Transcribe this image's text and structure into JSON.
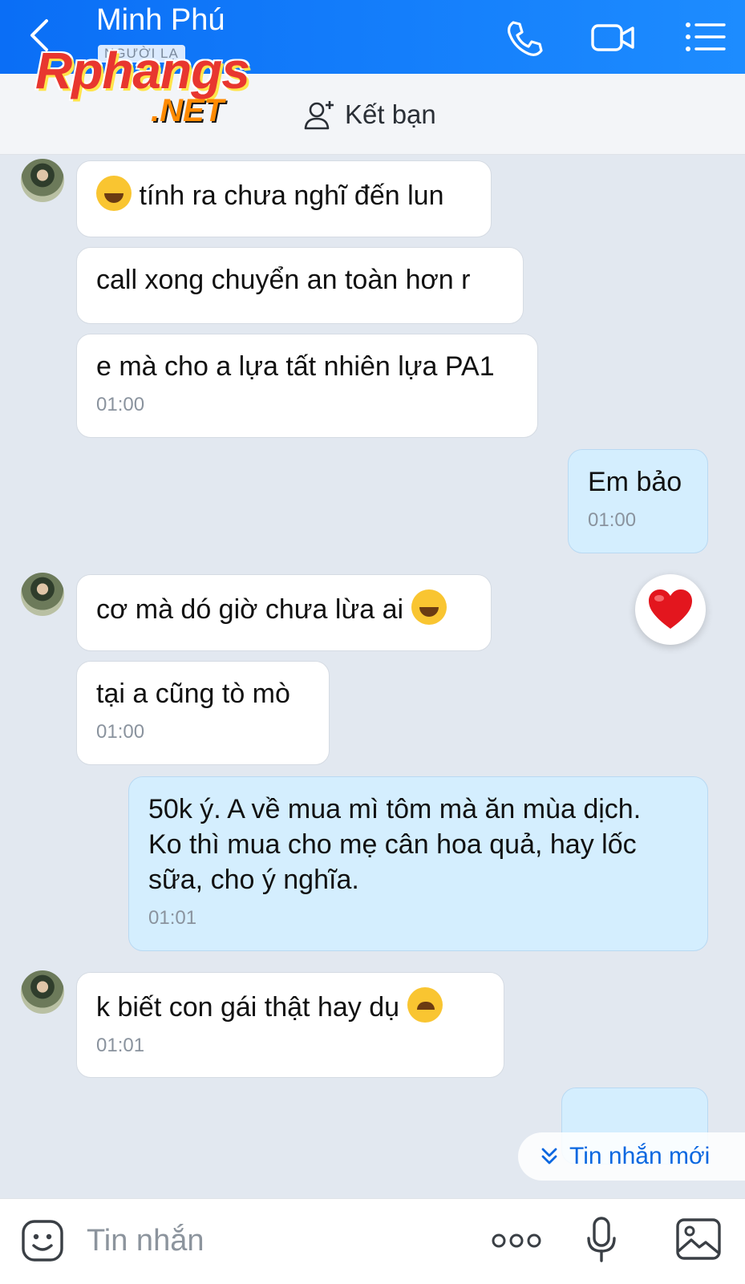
{
  "header": {
    "title": "Minh Phú",
    "subtitle": "NGƯỜI LẠ",
    "add_friend_label": "Kết bạn"
  },
  "watermark": {
    "line1": "Rphangs",
    "line2": ".NET"
  },
  "messages": [
    {
      "side": "received",
      "text": "tính ra chưa nghĩ đến lun",
      "emoji": "tears-of-joy"
    },
    {
      "side": "received",
      "text": "call xong chuyển an toàn hơn r"
    },
    {
      "side": "received",
      "text": "e mà cho a lựa tất nhiên lựa PA1",
      "time": "01:00"
    },
    {
      "side": "sent",
      "text": "Em bảo",
      "time": "01:00"
    },
    {
      "side": "received",
      "text": "cơ mà dó giờ chưa lừa ai",
      "emoji": "tears-of-joy",
      "reaction": "heart"
    },
    {
      "side": "received",
      "text": "tại a cũng tò mò",
      "time": "01:00"
    },
    {
      "side": "sent",
      "lines": [
        "50k ý. A về mua mì tôm mà ăn mùa dịch.",
        "Ko thì mua cho mẹ cân hoa quả, hay lốc",
        "sữa, cho ý nghĩa."
      ],
      "time": "01:01"
    },
    {
      "side": "received",
      "text": "k biết con gái thật hay dụ",
      "emoji": "wink",
      "time": "01:01"
    }
  ],
  "new_messages_label": "Tin nhắn mới",
  "composer": {
    "placeholder": "Tin nhắn"
  },
  "icons": {
    "back": "chevron-left-icon",
    "call": "phone-icon",
    "video": "video-camera-icon",
    "menu": "list-menu-icon",
    "add_friend": "add-person-icon",
    "sticker": "emoji-sticker-icon",
    "more": "more-dots-icon",
    "mic": "microphone-icon",
    "image": "image-icon",
    "reaction": "heart-icon",
    "new_messages": "double-chevron-down-icon"
  },
  "colors": {
    "header": "#0a6ef6",
    "sent_bubble": "#d4eefe",
    "received_bubble": "#ffffff",
    "background": "#e2e8f0",
    "accent": "#0a67e0"
  }
}
